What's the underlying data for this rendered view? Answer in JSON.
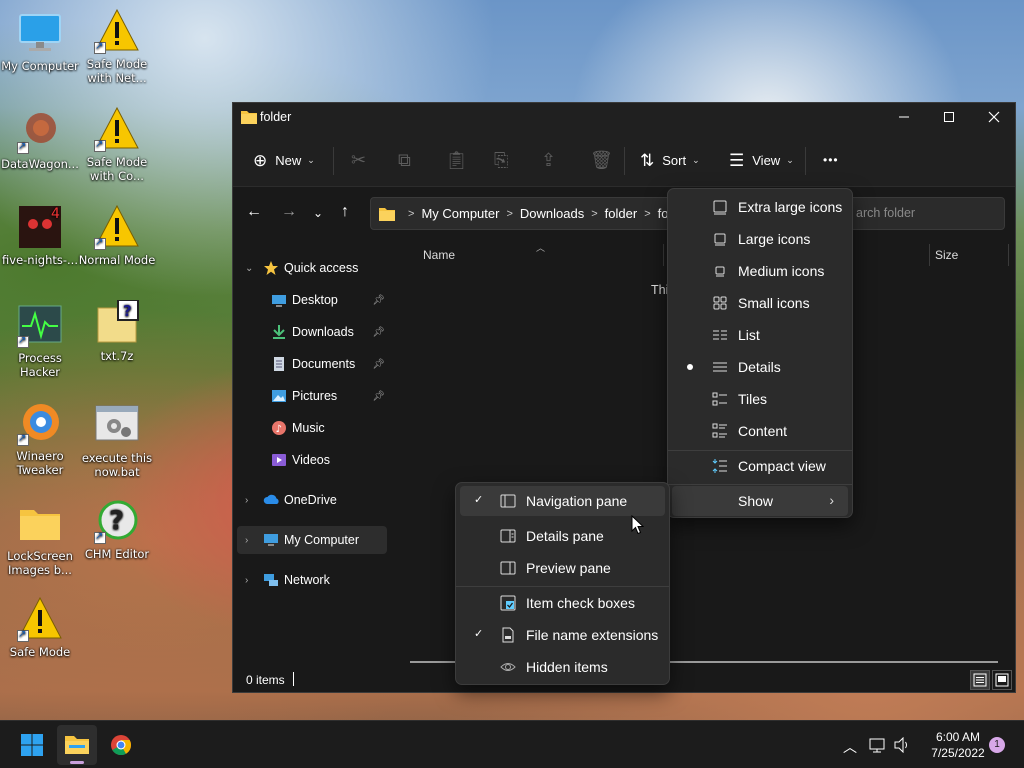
{
  "desktop": {
    "icons": [
      {
        "label": "My Computer",
        "icon": "monitor-icon"
      },
      {
        "label": "Safe Mode with Net...",
        "icon": "warning-icon"
      },
      {
        "label": "DataWagon...",
        "icon": "app-icon"
      },
      {
        "label": "Safe Mode with Co...",
        "icon": "warning-icon"
      },
      {
        "label": "five-nights-...",
        "icon": "game-icon"
      },
      {
        "label": "Normal Mode",
        "icon": "warning-icon"
      },
      {
        "label": "Process Hacker",
        "icon": "process-hacker-icon"
      },
      {
        "label": "txt.7z",
        "icon": "archive-icon"
      },
      {
        "label": "Winaero Tweaker",
        "icon": "winaero-icon"
      },
      {
        "label": "execute this now.bat",
        "icon": "batch-file-icon"
      },
      {
        "label": "LockScreen Images b...",
        "icon": "folder-icon"
      },
      {
        "label": "CHM Editor",
        "icon": "chm-icon"
      },
      {
        "label": "Safe Mode",
        "icon": "warning-icon"
      }
    ]
  },
  "window": {
    "title": "folder",
    "toolbar": {
      "new_label": "New",
      "sort_label": "Sort",
      "view_label": "View",
      "more_label": "•••"
    },
    "address": {
      "segments": [
        "My Computer",
        "Downloads",
        "folder",
        "folc"
      ],
      "search_placeholder": "Search folder",
      "search_visible_text": "arch folder"
    },
    "sidebar": {
      "quick_access": "Quick access",
      "pinned": [
        "Desktop",
        "Downloads",
        "Documents",
        "Pictures"
      ],
      "unpinned": [
        "Music",
        "Videos"
      ],
      "onedrive": "OneDrive",
      "my_computer": "My Computer",
      "network": "Network"
    },
    "columns": {
      "name": "Name",
      "size": "Size"
    },
    "empty_message": "Thi",
    "status": {
      "items": "0 items"
    }
  },
  "view_menu": {
    "items": [
      {
        "label": "Extra large icons",
        "icon": "extra-large-icons-icon"
      },
      {
        "label": "Large icons",
        "icon": "large-icons-icon"
      },
      {
        "label": "Medium icons",
        "icon": "medium-icons-icon"
      },
      {
        "label": "Small icons",
        "icon": "small-icons-icon"
      },
      {
        "label": "List",
        "icon": "list-icon"
      },
      {
        "label": "Details",
        "icon": "details-icon",
        "selected": true
      },
      {
        "label": "Tiles",
        "icon": "tiles-icon"
      },
      {
        "label": "Content",
        "icon": "content-icon"
      }
    ],
    "compact_view": "Compact view",
    "show": "Show"
  },
  "show_menu": {
    "items": [
      {
        "label": "Navigation pane",
        "checked": true
      },
      {
        "label": "Details pane",
        "checked": false
      },
      {
        "label": "Preview pane",
        "checked": false
      },
      {
        "label": "Item check boxes",
        "checked": false
      },
      {
        "label": "File name extensions",
        "checked": true
      },
      {
        "label": "Hidden items",
        "checked": false
      }
    ]
  },
  "taskbar": {
    "time": "6:00 AM",
    "date": "7/25/2022",
    "notification_count": "1"
  },
  "colors": {
    "window_bg": "#191919",
    "menu_bg": "#2b2b2b",
    "accent": "#60cdff",
    "folder_yellow": "#f6c440"
  }
}
